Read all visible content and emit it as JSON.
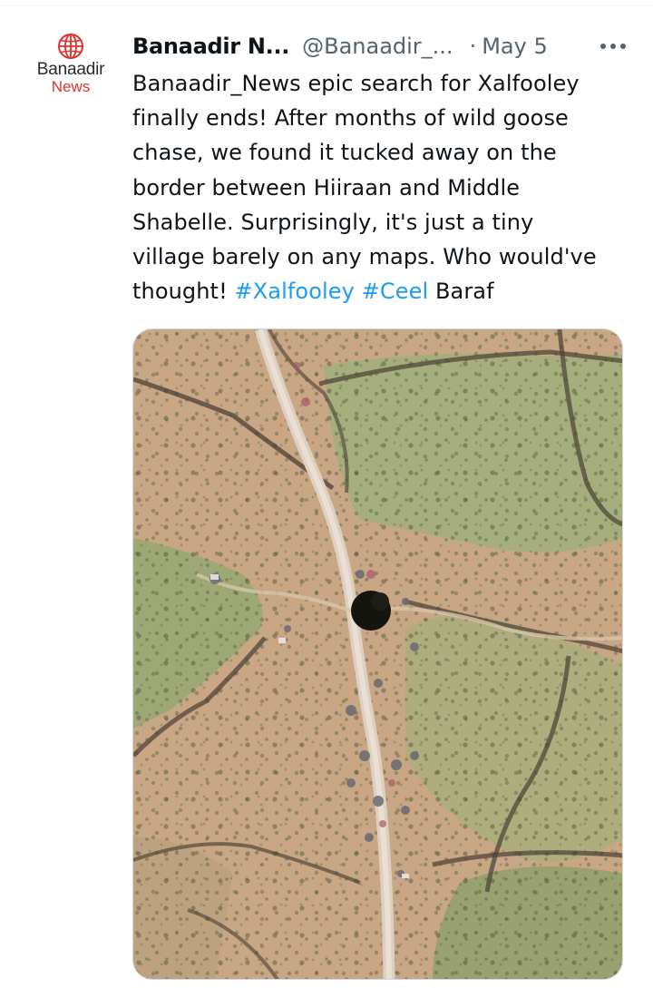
{
  "tweet": {
    "author": {
      "display_name": "Banaadir N...",
      "handle": "@Banaadir_...",
      "avatar_line1": "Banaadir",
      "avatar_line2": "News"
    },
    "separator": "·",
    "date": "May 5",
    "more_icon": "more-horizontal-icon",
    "text_lines": [
      "Banaadir_News epic search for Xalfooley",
      "finally ends! After months of wild goose",
      "chase, we found it tucked away on the",
      "border between Hiiraan and Middle",
      "Shabelle. Surprisingly, it's just a tiny",
      "village barely on any maps. Who would've"
    ],
    "last_line": {
      "prefix": "thought! ",
      "hashtag1": "#Xalfooley",
      "space": " ",
      "hashtag2": "#Ceel",
      "suffix": " Baraf"
    },
    "media": {
      "kind": "satellite-image"
    }
  },
  "colors": {
    "text": "#0f1419",
    "secondary": "#536471",
    "link": "#1d9bf0",
    "brand_red": "#e0312b"
  }
}
